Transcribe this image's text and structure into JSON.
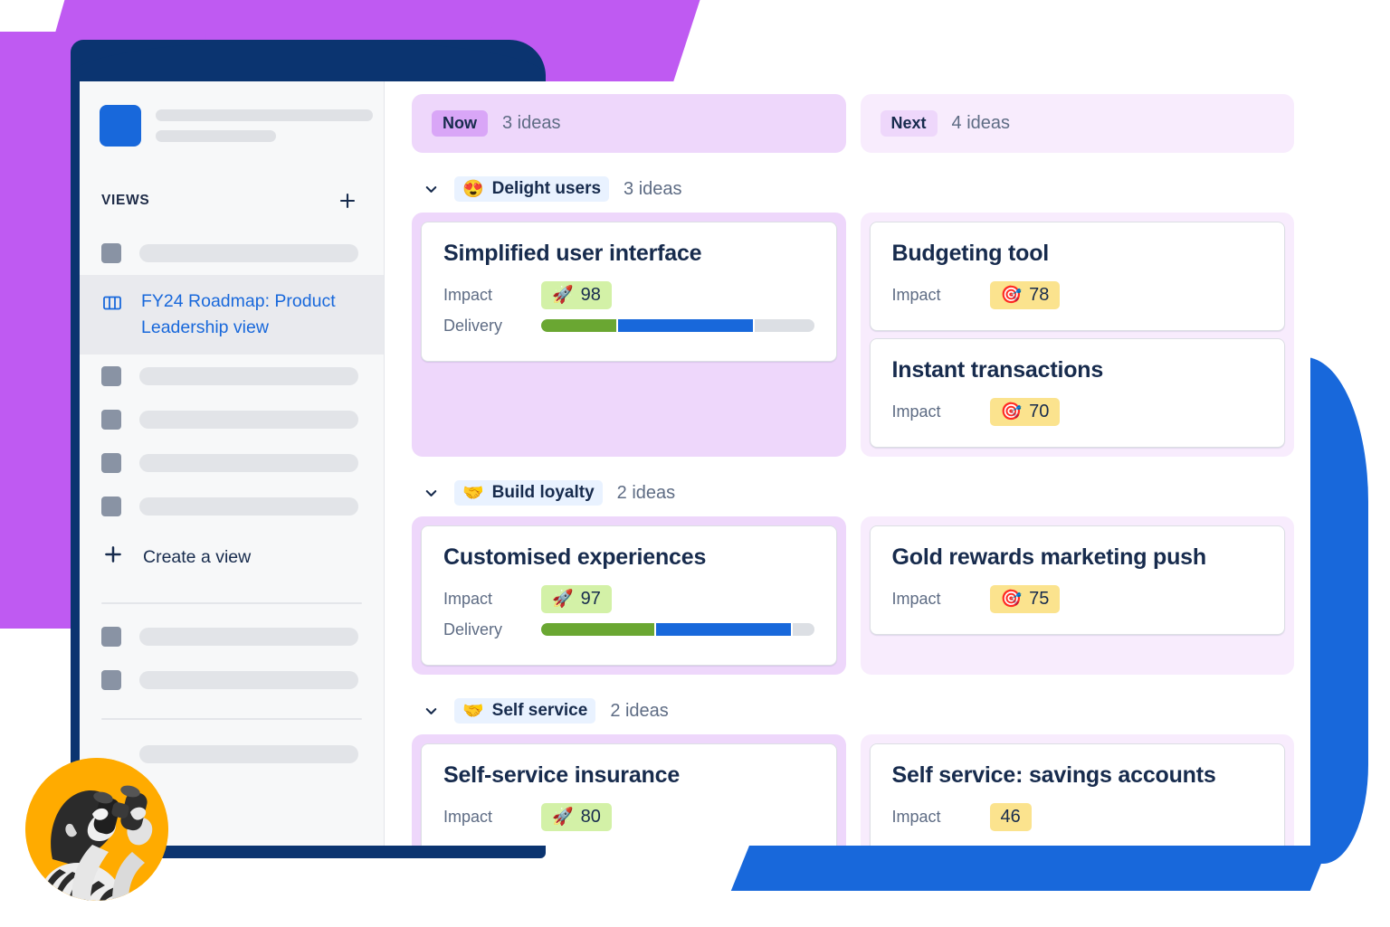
{
  "window": {
    "title": "FY24 Roadmap: Product Leadership view"
  },
  "colors": {
    "brand_blue": "#1868db",
    "navy_frame": "#0b3470",
    "purple_shape": "#bf5af2",
    "now_lane": "#eed7fb",
    "next_lane": "#f8ecfd",
    "impact_green": "#d3f1a7",
    "impact_yellow": "#fbe38e",
    "delivery_green": "#6aa732",
    "delivery_blue": "#1868db",
    "delivery_grey": "#dcdfe4",
    "avatar_orange": "#ffab00",
    "link_blue": "#1868db"
  },
  "sidebar": {
    "section_label": "VIEWS",
    "add_view_icon": "plus-icon",
    "placeholder_rows_top": 1,
    "active_view": {
      "label": "FY24 Roadmap: Product Leadership view",
      "icon": "board-columns-icon"
    },
    "placeholder_rows_middle": 4,
    "create_view": {
      "label": "Create a view",
      "icon": "plus-icon"
    },
    "placeholder_rows_bottom": 2,
    "placeholder_rows_footer": 1
  },
  "board": {
    "lanes": [
      {
        "id": "now",
        "chip": "Now",
        "count": "3 ideas"
      },
      {
        "id": "next",
        "chip": "Next",
        "count": "4 ideas"
      }
    ],
    "groups": [
      {
        "emoji": "😍",
        "emoji_name": "smiling-face-with-hearts-icon",
        "name": "Delight users",
        "count": "3 ideas",
        "collapse_icon": "chevron-down-icon",
        "now_cards": [
          {
            "title": "Simplified user interface",
            "impact_label": "Impact",
            "impact_value": "98",
            "impact_emoji": "🚀",
            "impact_emoji_name": "rocket-icon",
            "impact_tone": "green",
            "delivery_label": "Delivery",
            "delivery": {
              "green": 28,
              "blue": 50,
              "grey": 22
            }
          }
        ],
        "next_cards": [
          {
            "title": "Budgeting tool",
            "impact_label": "Impact",
            "impact_value": "78",
            "impact_emoji": "🎯",
            "impact_emoji_name": "bullseye-icon",
            "impact_tone": "yellow"
          },
          {
            "title": "Instant transactions",
            "impact_label": "Impact",
            "impact_value": "70",
            "impact_emoji": "🎯",
            "impact_emoji_name": "bullseye-icon",
            "impact_tone": "yellow"
          }
        ]
      },
      {
        "emoji": "🤝",
        "emoji_name": "handshake-icon",
        "name": "Build loyalty",
        "count": "2 ideas",
        "collapse_icon": "chevron-down-icon",
        "now_cards": [
          {
            "title": "Customised experiences",
            "impact_label": "Impact",
            "impact_value": "97",
            "impact_emoji": "🚀",
            "impact_emoji_name": "rocket-icon",
            "impact_tone": "green",
            "delivery_label": "Delivery",
            "delivery": {
              "green": 42,
              "blue": 50,
              "grey": 8
            }
          }
        ],
        "next_cards": [
          {
            "title": "Gold rewards marketing push",
            "impact_label": "Impact",
            "impact_value": "75",
            "impact_emoji": "🎯",
            "impact_emoji_name": "bullseye-icon",
            "impact_tone": "yellow"
          }
        ]
      },
      {
        "emoji": "🤝",
        "emoji_name": "handshake-icon",
        "name": "Self service",
        "count": "2 ideas",
        "collapse_icon": "chevron-down-icon",
        "now_cards": [
          {
            "title": "Self-service insurance",
            "impact_label": "Impact",
            "impact_value": "80",
            "impact_emoji": "🚀",
            "impact_emoji_name": "rocket-icon",
            "impact_tone": "green"
          }
        ],
        "next_cards": [
          {
            "title": "Self service: savings accounts",
            "impact_label": "Impact",
            "impact_value": "46",
            "impact_emoji": "",
            "impact_emoji_name": "none",
            "impact_tone": "yellow"
          }
        ]
      }
    ]
  }
}
